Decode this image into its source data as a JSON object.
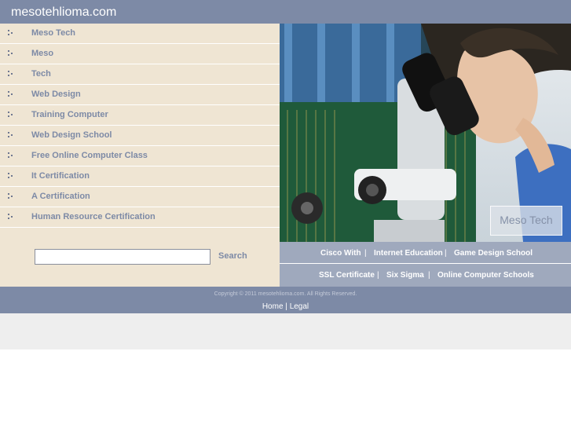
{
  "header": {
    "site_title": "mesotehlioma.com"
  },
  "menu": {
    "items": [
      {
        "label": "Meso Tech"
      },
      {
        "label": "Meso"
      },
      {
        "label": "Tech"
      },
      {
        "label": "Web Design"
      },
      {
        "label": "Training Computer"
      },
      {
        "label": "Web Design School"
      },
      {
        "label": "Free Online Computer Class"
      },
      {
        "label": "It Certification"
      },
      {
        "label": "A Certification"
      },
      {
        "label": "Human Resource Certification"
      }
    ]
  },
  "search": {
    "value": "",
    "button_label": "Search"
  },
  "hero": {
    "badge_text": "Meso Tech"
  },
  "related_links": {
    "row1": [
      "Cisco With",
      "Internet Education",
      "Game Design School"
    ],
    "row2": [
      "SSL Certificate",
      "Six Sigma",
      "Online Computer Schools"
    ],
    "separator": "|"
  },
  "footer": {
    "copyright": "Copyright © 2011 mesotehlioma.com. All Rights Reserved.",
    "home_label": "Home",
    "separator": "|",
    "legal_label": "Legal"
  },
  "colors": {
    "header_bg": "#7d8aa6",
    "panel_bg": "#efe5d3",
    "link_bar_bg": "#9fa9bd",
    "band_bg": "#eeeeee"
  }
}
